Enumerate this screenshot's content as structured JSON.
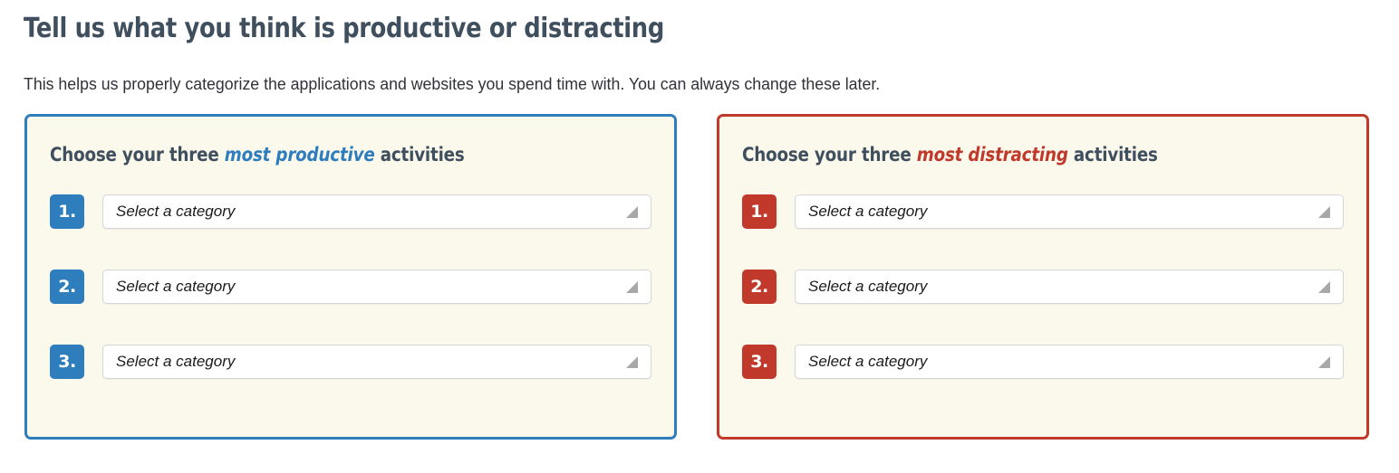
{
  "page": {
    "title": "Tell us what you think is productive or distracting",
    "subtitle": "This helps us properly categorize the applications and websites you spend time with. You can always change these later.",
    "background_color": "#ffffff",
    "title_color": "#3f4f5e"
  },
  "panels": [
    {
      "id": "most-productive",
      "accent_color": "#2e7dbd",
      "background_color": "#fbf8ec",
      "heading": {
        "prefix": "Choose your three ",
        "emphasis": "most productive",
        "suffix": " activities"
      },
      "rows": [
        {
          "number": "1.",
          "value": "Select a category",
          "placeholder": "Select a category",
          "arrow_icon": "triangle-down-left-icon"
        },
        {
          "number": "2.",
          "value": "Select a category",
          "placeholder": "Select a category",
          "arrow_icon": "triangle-down-left-icon"
        },
        {
          "number": "3.",
          "value": "Select a category",
          "placeholder": "Select a category",
          "arrow_icon": "triangle-down-left-icon"
        }
      ]
    },
    {
      "id": "most-distracting",
      "accent_color": "#c0392b",
      "background_color": "#fbf8ec",
      "heading": {
        "prefix": "Choose your three ",
        "emphasis": "most distracting",
        "suffix": " activities"
      },
      "rows": [
        {
          "number": "1.",
          "value": "Select a category",
          "placeholder": "Select a category",
          "arrow_icon": "triangle-down-left-icon"
        },
        {
          "number": "2.",
          "value": "Select a category",
          "placeholder": "Select a category",
          "arrow_icon": "triangle-down-left-icon"
        },
        {
          "number": "3.",
          "value": "Select a category",
          "placeholder": "Select a category",
          "arrow_icon": "triangle-down-left-icon"
        }
      ]
    }
  ]
}
